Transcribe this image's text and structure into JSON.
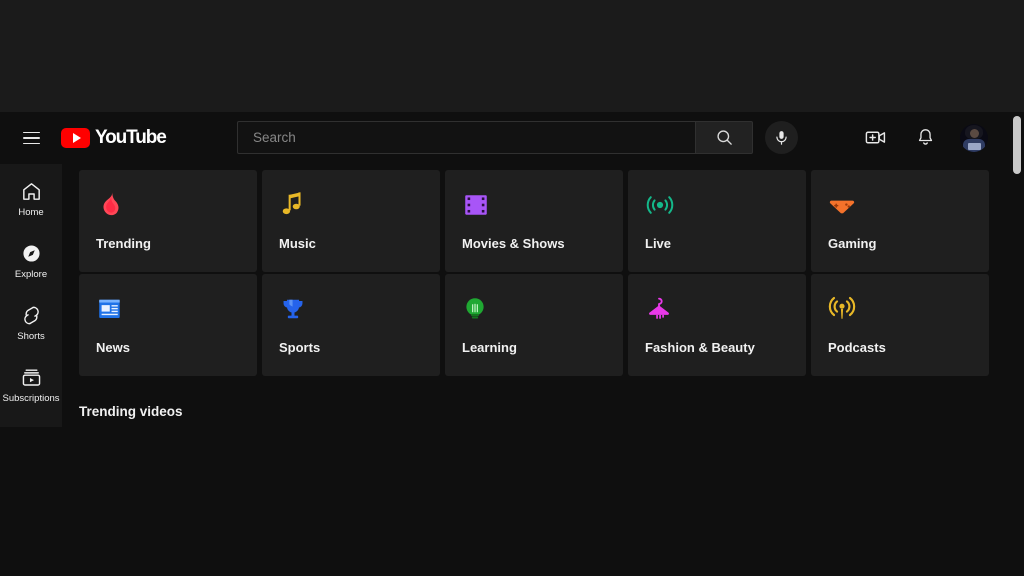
{
  "app": {
    "brand": "YouTube",
    "logo_icon": "youtube-play-logo"
  },
  "masthead": {
    "menu_icon": "hamburger-menu-icon",
    "search": {
      "value": "",
      "placeholder": "Search",
      "search_icon": "magnifier-search-icon",
      "mic_icon": "microphone-icon"
    },
    "create_icon": "create-video-icon",
    "notifications_icon": "bell-notifications-icon",
    "avatar_icon": "user-avatar"
  },
  "sidebar": {
    "items": [
      {
        "label": "Home",
        "icon": "home-icon",
        "active": false
      },
      {
        "label": "Explore",
        "icon": "compass-explore-icon",
        "active": true
      },
      {
        "label": "Shorts",
        "icon": "shorts-icon",
        "active": false
      },
      {
        "label": "Subscriptions",
        "icon": "subscriptions-icon",
        "active": false
      }
    ]
  },
  "main": {
    "categories": [
      {
        "label": "Trending",
        "icon": "flame-icon",
        "color": "#ff4757"
      },
      {
        "label": "Music",
        "icon": "music-note-icon",
        "color": "#e8b827"
      },
      {
        "label": "Movies & Shows",
        "icon": "film-strip-icon",
        "color": "#a855f7"
      },
      {
        "label": "Live",
        "icon": "broadcast-icon",
        "color": "#14b88a"
      },
      {
        "label": "Gaming",
        "icon": "gamepad-icon",
        "color": "#f4722b"
      },
      {
        "label": "News",
        "icon": "newspaper-icon",
        "color": "#1f72e8"
      },
      {
        "label": "Sports",
        "icon": "trophy-icon",
        "color": "#2563eb"
      },
      {
        "label": "Learning",
        "icon": "lightbulb-icon",
        "color": "#1fa832"
      },
      {
        "label": "Fashion & Beauty",
        "icon": "clothes-hanger-icon",
        "color": "#e838e8"
      },
      {
        "label": "Podcasts",
        "icon": "podcast-icon",
        "color": "#e8b827"
      }
    ],
    "section_title": "Trending videos"
  },
  "theme": {
    "page_background": "#0f0f0f",
    "card_background": "#1f1f1f",
    "sidebar_background": "#181818",
    "text_primary": "#f1f1f1",
    "brand_red": "#ff0000"
  }
}
